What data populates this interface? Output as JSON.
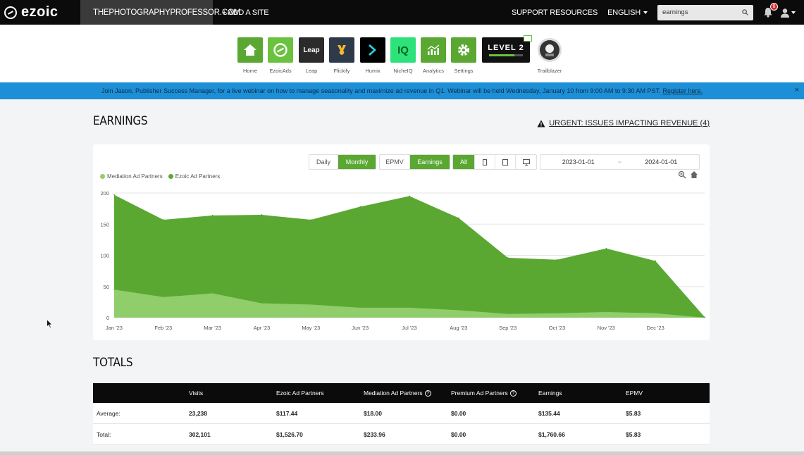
{
  "nav": {
    "brand": "ezoic",
    "site": "THEPHOTOGRAPHYPROFESSOR.COM",
    "add_site": "+ ADD A SITE",
    "support": "SUPPORT RESOURCES",
    "language": "ENGLISH",
    "search_value": "earnings",
    "notifications": "6"
  },
  "apps": [
    {
      "label": "Home",
      "icon": "home-icon",
      "color": "#5aa832"
    },
    {
      "label": "EzoicAds",
      "icon": "ezoic-ads-icon",
      "color": "#6ac23f"
    },
    {
      "label": "Leap",
      "icon": "leap-icon",
      "color": "#2b2b2b",
      "tile_text": "Leap"
    },
    {
      "label": "Flickify",
      "icon": "flickify-icon",
      "color": "#2e3a4a"
    },
    {
      "label": "Humix",
      "icon": "humix-icon",
      "color": "#000000"
    },
    {
      "label": "NicheIQ",
      "icon": "nicheiq-icon",
      "color": "#2ee27a",
      "tile_text": "IQ"
    },
    {
      "label": "Analytics",
      "icon": "analytics-icon",
      "color": "#5aa832"
    },
    {
      "label": "Settings",
      "icon": "gear-icon",
      "color": "#5aa832"
    },
    {
      "label": "Trailblazer",
      "icon": "trailblazer-icon",
      "color": "#333333"
    }
  ],
  "level": {
    "text": "LEVEL 2",
    "progress": 0.75
  },
  "banner": {
    "text": "Join Jason, Publisher Success Manager, for a live webinar on how to manage seasonality and maximize ad revenue in Q1. Webinar will be held Wednesday, January 10 from 9:00 AM to 9:30 AM PST.",
    "link": "Register here.",
    "close": "×"
  },
  "earnings": {
    "title": "EARNINGS",
    "urgent": "URGENT: ISSUES IMPACTING REVENUE (4)",
    "buttons": {
      "daily": "Daily",
      "monthly": "Monthly",
      "epmv": "EPMV",
      "earnings": "Earnings",
      "all": "All",
      "sep": "~"
    },
    "date_start": "2023-01-01",
    "date_end": "2024-01-01"
  },
  "chart_data": {
    "type": "area",
    "stacked": true,
    "categories": [
      "Jan '23",
      "Feb '23",
      "Mar '23",
      "Apr '23",
      "May '23",
      "Jun '23",
      "Jul '23",
      "Aug '23",
      "Sep '23",
      "Oct '23",
      "Nov '23",
      "Dec '23",
      ""
    ],
    "yticks": [
      0,
      50,
      100,
      150,
      200
    ],
    "ylim": [
      0,
      200
    ],
    "grid": true,
    "legend_position": "top-left",
    "series": [
      {
        "name": "Mediation Ad Partners",
        "color": "#8fce6a",
        "values": [
          45,
          33,
          39,
          23,
          21,
          16,
          16,
          12,
          6,
          7,
          9,
          7,
          0
        ]
      },
      {
        "name": "Ezoic Ad Partners",
        "color": "#5aa832",
        "values": [
          152,
          124,
          125,
          142,
          136,
          162,
          179,
          148,
          90,
          86,
          102,
          84,
          1
        ]
      }
    ]
  },
  "totals": {
    "title": "TOTALS",
    "columns": [
      "",
      "Visits",
      "Ezoic Ad Partners",
      "Mediation Ad Partners",
      "Premium Ad Partners",
      "Earnings",
      "EPMV"
    ],
    "rows": [
      [
        "Average:",
        "23,238",
        "$117.44",
        "$18.00",
        "$0.00",
        "$135.44",
        "$5.83"
      ],
      [
        "Total:",
        "302,101",
        "$1,526.70",
        "$233.96",
        "$0.00",
        "$1,760.66",
        "$5.83"
      ]
    ]
  }
}
